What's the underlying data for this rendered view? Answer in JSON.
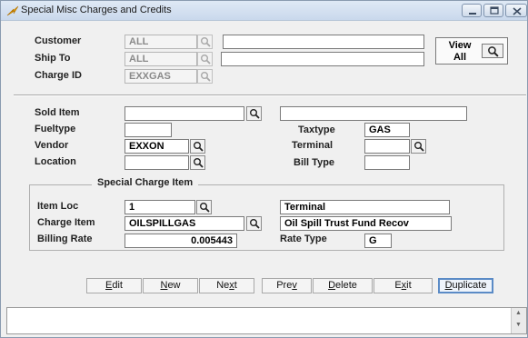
{
  "window": {
    "title": "Special Misc Charges and Credits"
  },
  "header": {
    "customer": {
      "label": "Customer",
      "code": "ALL",
      "name": ""
    },
    "ship_to": {
      "label": "Ship To",
      "code": "ALL",
      "name": ""
    },
    "charge_id": {
      "label": "Charge ID",
      "code": "EXXGAS"
    },
    "view_all_label": "View All"
  },
  "details": {
    "sold_item": {
      "label": "Sold Item",
      "code": "",
      "description": ""
    },
    "fueltype": {
      "label": "Fueltype",
      "value": ""
    },
    "taxtype": {
      "label": "Taxtype",
      "value": "GAS"
    },
    "vendor": {
      "label": "Vendor",
      "value": "EXXON"
    },
    "terminal": {
      "label": "Terminal",
      "value": ""
    },
    "location": {
      "label": "Location",
      "value": ""
    },
    "bill_type": {
      "label": "Bill Type",
      "value": ""
    }
  },
  "special_charge_item": {
    "group_title": "Special Charge Item",
    "item_loc": {
      "label": "Item Loc",
      "code": "1",
      "description": "Terminal"
    },
    "charge_item": {
      "label": "Charge Item",
      "code": "OILSPILLGAS",
      "description": "Oil Spill Trust Fund Recov"
    },
    "billing_rate": {
      "label": "Billing Rate",
      "value": "0.005443"
    },
    "rate_type": {
      "label": "Rate Type",
      "value": "G"
    }
  },
  "buttons": {
    "edit": {
      "pre": "",
      "u": "E",
      "post": "dit"
    },
    "new": {
      "pre": "",
      "u": "N",
      "post": "ew"
    },
    "next": {
      "pre": "Ne",
      "u": "x",
      "post": "t"
    },
    "prev": {
      "pre": "Pre",
      "u": "v",
      "post": ""
    },
    "delete": {
      "pre": "",
      "u": "D",
      "post": "elete"
    },
    "exit": {
      "pre": "E",
      "u": "x",
      "post": "it"
    },
    "duplicate": {
      "pre": "",
      "u": "D",
      "post": "uplicate"
    }
  },
  "status_bar": {
    "text": ""
  },
  "icons": {
    "app": "lightning-icon",
    "lookup": "magnifier-icon"
  },
  "colors": {
    "title_bg": "#c9d8ec",
    "window_bg": "#f0f0f0",
    "default_button_border": "#5b8bc6"
  }
}
